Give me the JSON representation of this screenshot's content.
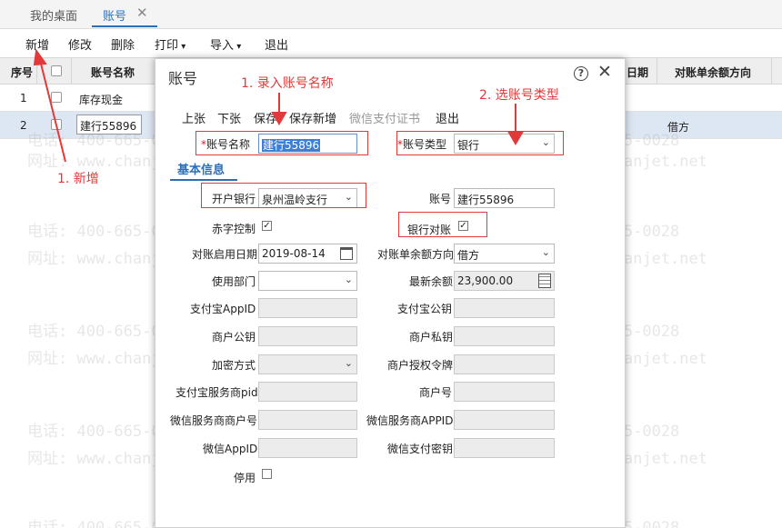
{
  "tabs": {
    "desk": "我的桌面",
    "active": "账号",
    "close": "✕"
  },
  "toolbar": {
    "add": "新增",
    "edit": "修改",
    "delete": "删除",
    "print": "打印",
    "import": "导入",
    "exit": "退出"
  },
  "grid": {
    "headers": {
      "seq": "序号",
      "name": "账号名称",
      "date": "日期",
      "direction": "对账单余额方向"
    },
    "rows": [
      {
        "seq": "1",
        "name": "库存现金",
        "direction": ""
      },
      {
        "seq": "2",
        "name": "建行55896",
        "direction": "借方"
      }
    ]
  },
  "watermark": {
    "phone": "电话: 400-665-0028",
    "url": "网址: www.chanjet.net"
  },
  "dialog": {
    "title": "账号",
    "help": "?",
    "close": "✕",
    "toolbar": {
      "prev": "上张",
      "next": "下张",
      "save": "保存",
      "save_new": "保存新增",
      "wechat_cert": "微信支付证书",
      "exit": "退出"
    },
    "section": "基本信息",
    "fields": {
      "account_name_label": "账号名称",
      "account_name": "建行55896",
      "account_type_label": "账号类型",
      "account_type": "银行",
      "bank_label": "开户银行",
      "bank": "泉州温岭支行",
      "account_no_label": "账号",
      "account_no": "建行55896",
      "red_control_label": "赤字控制",
      "bank_recon_label": "银行对账",
      "recon_date_label": "对账启用日期",
      "recon_date": "2019-08-14",
      "direction_label": "对账单余额方向",
      "direction": "借方",
      "dept_label": "使用部门",
      "balance_label": "最新余额",
      "balance": "23,900.00",
      "alipay_appid_label": "支付宝AppID",
      "alipay_pubkey_label": "支付宝公钥",
      "merchant_pubkey_label": "商户公钥",
      "merchant_privkey_label": "商户私钥",
      "encrypt_label": "加密方式",
      "merchant_auth_label": "商户授权令牌",
      "alipay_pid_label": "支付宝服务商pid",
      "merchant_no_label": "商户号",
      "wechat_sp_mch_label": "微信服务商商户号",
      "wechat_sp_appid_label": "微信服务商APPID",
      "wechat_appid_label": "微信AppID",
      "wechat_key_label": "微信支付密钥",
      "disabled_label": "停用"
    },
    "required_mark": "*"
  },
  "annotations": {
    "step1": "1. 新增",
    "step1b": "1. 录入账号名称",
    "step2": "2. 选账号类型"
  },
  "colors": {
    "accent": "#2c6fb7",
    "annotation": "#e23a3a",
    "selection": "#3c7fd6"
  }
}
